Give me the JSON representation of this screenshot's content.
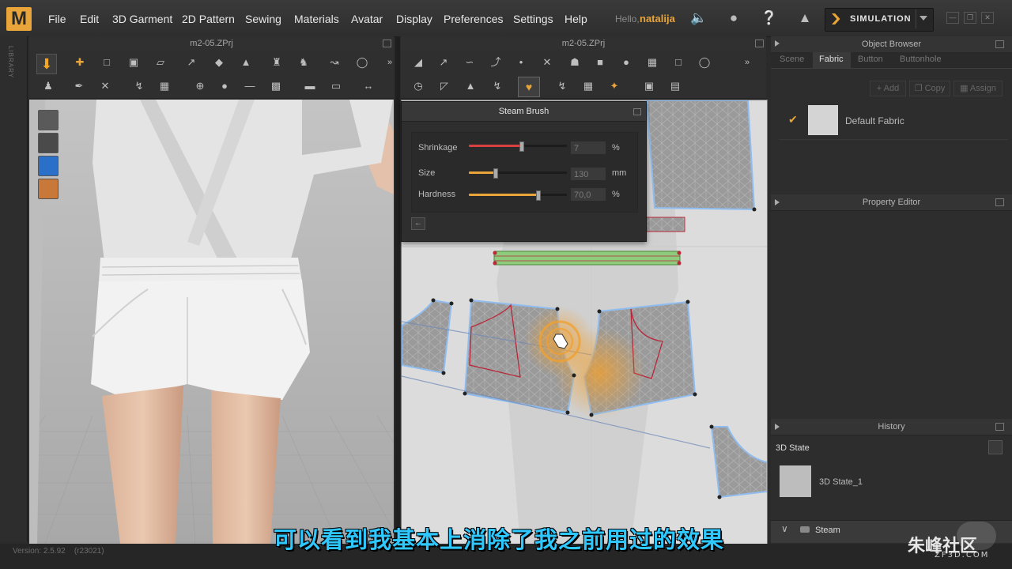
{
  "app": {
    "logo": "M",
    "menu": [
      "File",
      "Edit",
      "3D Garment",
      "2D Pattern",
      "Sewing",
      "Materials",
      "Avatar",
      "Display",
      "Preferences",
      "Settings",
      "Help"
    ],
    "hello": "Hello,",
    "user": "natalija",
    "simulation_label": "SIMULATION"
  },
  "panels": {
    "left_title": "m2-05.ZPrj",
    "middle_title": "m2-05.ZPrj",
    "library_label": "LIBRARY"
  },
  "steam_brush": {
    "title": "Steam Brush",
    "shrinkage": {
      "label": "Shrinkage",
      "value": "7",
      "unit": "%",
      "level": 0.53
    },
    "size": {
      "label": "Size",
      "value": "130",
      "unit": "mm",
      "level": 0.27
    },
    "hardness": {
      "label": "Hardness",
      "value": "70,0",
      "unit": "%",
      "level": 0.7
    }
  },
  "object_browser": {
    "title": "Object Browser",
    "tabs": [
      "Scene",
      "Fabric",
      "Button",
      "Buttonhole"
    ],
    "active_tab": "Fabric",
    "buttons": {
      "add": "Add",
      "copy": "Copy",
      "assign": "Assign"
    },
    "fabric_item": "Default Fabric"
  },
  "property_editor": {
    "title": "Property Editor"
  },
  "history": {
    "title": "History",
    "state_header": "3D State",
    "state_item": "3D State_1",
    "steam_label": "Steam"
  },
  "footer": {
    "version": "Version: 2.5.92",
    "build": "(r23021)"
  },
  "subtitle": "可以看到我基本上消除了我之前用过的效果",
  "watermark": {
    "brand": "朱峰社区",
    "site": "ZF3D.COM"
  },
  "colors": {
    "accent": "#e9a43a",
    "shrinkage": "#d94040",
    "slider": "#e9a43a",
    "pattern_seam": "#b8283a",
    "subtitle": "#2ec8ff"
  }
}
